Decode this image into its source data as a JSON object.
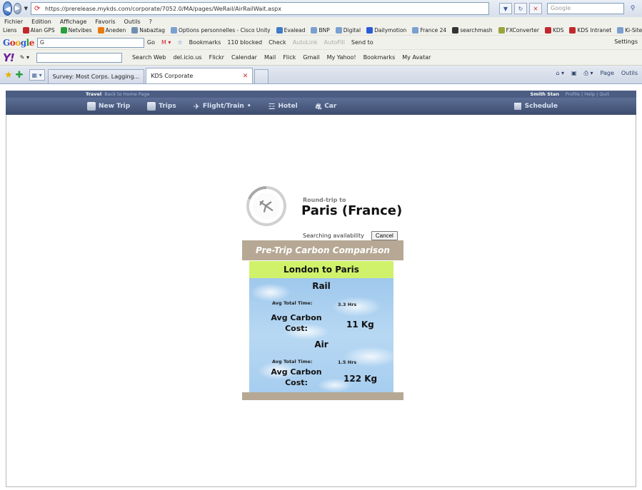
{
  "browser": {
    "url": "https://prerelease.mykds.com/corporate/7052.0/MA/pages/WeRail/AirRailWait.aspx",
    "search_placeholder": "Google",
    "menu": [
      "Fichier",
      "Edition",
      "Affichage",
      "Favoris",
      "Outils",
      "?"
    ],
    "links_label": "Liens",
    "links": [
      "Alan GPS",
      "Netvibes",
      "Aneden",
      "Nabaztag",
      "Options personnelles - Cisco Unity",
      "Evalead",
      "BNP",
      "Digital",
      "Dailymotion",
      "France 24",
      "searchmash",
      "FXConverter",
      "KDS",
      "KDS Intranet",
      "Ki-Site"
    ],
    "google_toolbar": {
      "input": "G",
      "go": "Go",
      "items": [
        "Bookmarks",
        "110 blocked",
        "Check",
        "AutoLink",
        "AutoFill",
        "Send to"
      ],
      "settings": "Settings"
    },
    "yahoo_toolbar": {
      "items": [
        "Search Web",
        "del.icio.us",
        "Flickr",
        "Calendar",
        "Mail",
        "Flick",
        "Gmail",
        "My Yahoo!",
        "Bookmarks",
        "My Avatar"
      ]
    },
    "tabs": [
      {
        "label": "Survey: Most Corps. Lagging..."
      },
      {
        "label": "KDS Corporate"
      }
    ],
    "tab_tools": [
      "Page",
      "Outils"
    ]
  },
  "site": {
    "travel": "Travel",
    "back_link": "Back to Home Page",
    "user": "Smith Stan",
    "user_links": "Profile | Help | Quit",
    "nav": [
      "New Trip",
      "Trips",
      "Flight/Train",
      "Hotel",
      "Car"
    ],
    "schedule": "Schedule"
  },
  "search": {
    "roundtrip_label": "Round-trip to",
    "destination": "Paris (France)",
    "status": "Searching availability",
    "cancel": "Cancel"
  },
  "carbon": {
    "title": "Pre-Trip Carbon Comparison",
    "route": "London to Paris",
    "rail": {
      "mode": "Rail",
      "time_label": "Avg Total Time:",
      "time": "3.3 Hrs",
      "carbon_label_1": "Avg Carbon",
      "carbon_label_2": "Cost:",
      "carbon": "11 Kg"
    },
    "air": {
      "mode": "Air",
      "time_label": "Avg Total Time:",
      "time": "1.5 Hrs",
      "carbon_label_1": "Avg Carbon",
      "carbon_label_2": "Cost:",
      "carbon": "122 Kg"
    }
  },
  "colors": {
    "accent_header": "#4c5d83",
    "panel_tan": "#b6a894",
    "route_green": "#cff26a",
    "sky_blue": "#a6cdef"
  }
}
